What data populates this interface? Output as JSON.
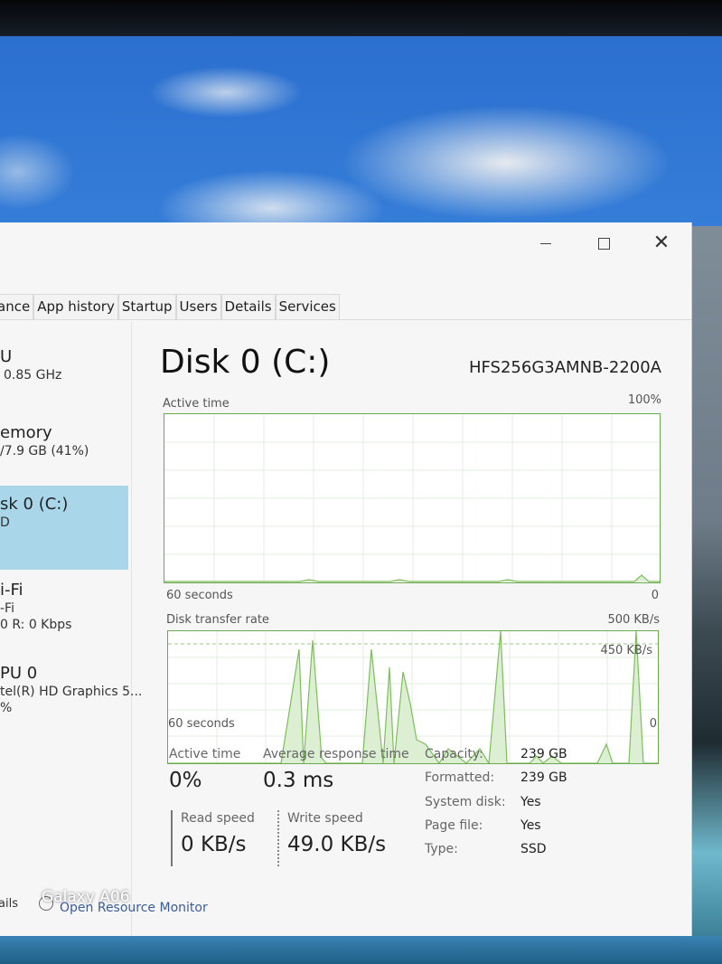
{
  "window": {
    "buttons": {
      "minimize": "minimize",
      "maximize": "maximize",
      "close": "close"
    }
  },
  "tabs": [
    {
      "label": "ance"
    },
    {
      "label": "App history"
    },
    {
      "label": "Startup"
    },
    {
      "label": "Users"
    },
    {
      "label": "Details"
    },
    {
      "label": "Services"
    }
  ],
  "sidebar": {
    "items": [
      {
        "title": "U",
        "sub": "0.85 GHz",
        "sub2": ""
      },
      {
        "title": "emory",
        "sub": "/7.9 GB (41%)",
        "sub2": ""
      },
      {
        "title": "sk 0 (C:)",
        "sub": "D",
        "sub2": ""
      },
      {
        "title": "i-Fi",
        "sub": "-Fi",
        "sub2": "0 R: 0 Kbps"
      },
      {
        "title": "PU 0",
        "sub": "tel(R) HD Graphics 5...",
        "sub2": "%"
      }
    ],
    "selected_index": 2
  },
  "main": {
    "title": "Disk 0 (C:)",
    "model": "HFS256G3AMNB-2200A",
    "active_graph": {
      "label": "Active time",
      "max_label": "100%",
      "time_label": "60 seconds",
      "min_label": "0"
    },
    "transfer_graph": {
      "label": "Disk transfer rate",
      "max_label": "500 KB/s",
      "line_label": "450 KB/s",
      "time_label": "60 seconds",
      "min_label": "0"
    },
    "stats": {
      "active_time_label": "Active time",
      "active_time_value": "0%",
      "avg_response_label": "Average response time",
      "avg_response_value": "0.3 ms",
      "read_label": "Read speed",
      "read_value": "0 KB/s",
      "write_label": "Write speed",
      "write_value": "49.0 KB/s"
    },
    "properties": [
      {
        "label": "Capacity:",
        "value": "239 GB"
      },
      {
        "label": "Formatted:",
        "value": "239 GB"
      },
      {
        "label": "System disk:",
        "value": "Yes"
      },
      {
        "label": "Page file:",
        "value": "Yes"
      },
      {
        "label": "Type:",
        "value": "SSD"
      }
    ]
  },
  "footer": {
    "details_label": "ails",
    "resource_monitor_label": "Open Resource Monitor"
  },
  "watermark": "Galaxy A06",
  "colors": {
    "graph_border": "#6aa84f",
    "graph_line": "#7cbf5a",
    "graph_fill": "#dcefd2",
    "selected_bg": "#a9d6e9"
  }
}
